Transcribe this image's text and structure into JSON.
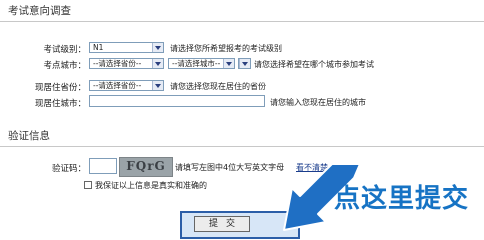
{
  "sections": {
    "exam_survey_title": "考试意向调查",
    "verify_title": "验证信息"
  },
  "fields": {
    "level": {
      "label": "考试级别：",
      "value": "N1",
      "hint": "请选择您所希望报考的考试级别"
    },
    "exam_city": {
      "label": "考点城市：",
      "province_value": "--请选择省份--",
      "city_value": "--请选择城市--",
      "third_value": "",
      "hint": "请您选择希望在哪个城市参加考试"
    },
    "residence_province": {
      "label": "现居住省份：",
      "value": "--请选择省份--",
      "hint": "请您选择您现在居住的省份"
    },
    "residence_city": {
      "label": "现居住城市：",
      "value": "",
      "hint": "请您输入您现在居住的城市"
    },
    "captcha": {
      "label": "验证码：",
      "image_text": "FQrG",
      "hint": "请填写左图中4位大写英文字母",
      "refresh_link": "看不清楚,换一张"
    },
    "confirm": {
      "label": "我保证以上信息是真实和准确的"
    }
  },
  "submit": {
    "label": "提交"
  },
  "annotation": {
    "text": "点这里提交",
    "color": "#1673c4"
  }
}
